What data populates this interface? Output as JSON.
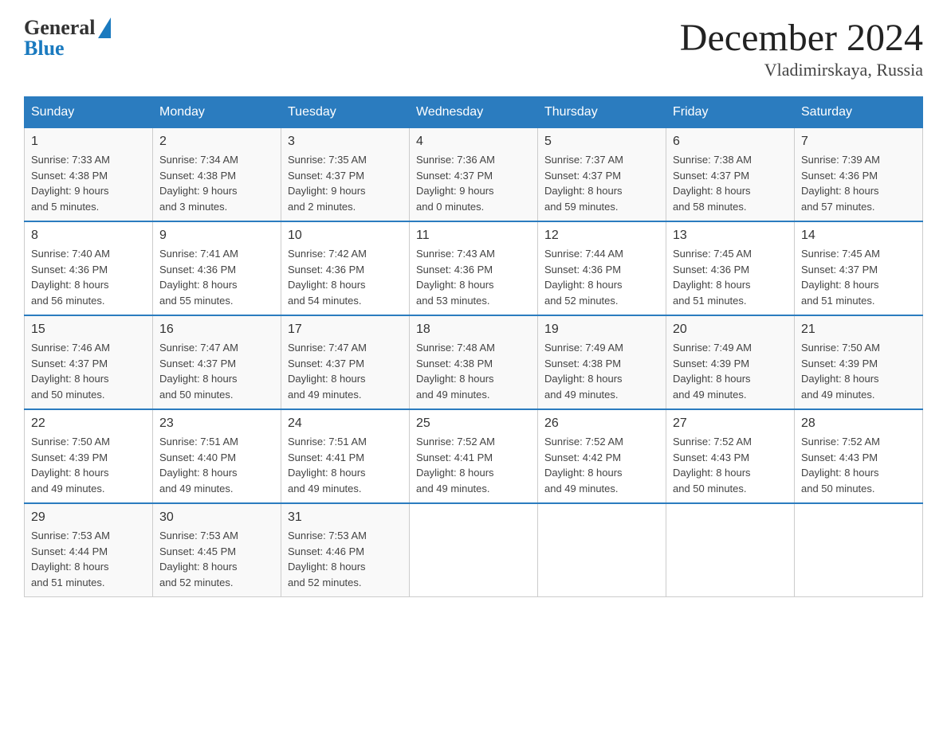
{
  "header": {
    "logo_general": "General",
    "logo_blue": "Blue",
    "title": "December 2024",
    "location": "Vladimirskaya, Russia"
  },
  "days_of_week": [
    "Sunday",
    "Monday",
    "Tuesday",
    "Wednesday",
    "Thursday",
    "Friday",
    "Saturday"
  ],
  "weeks": [
    [
      {
        "day": "1",
        "sunrise": "7:33 AM",
        "sunset": "4:38 PM",
        "daylight_hours": "9",
        "daylight_minutes": "5"
      },
      {
        "day": "2",
        "sunrise": "7:34 AM",
        "sunset": "4:38 PM",
        "daylight_hours": "9",
        "daylight_minutes": "3"
      },
      {
        "day": "3",
        "sunrise": "7:35 AM",
        "sunset": "4:37 PM",
        "daylight_hours": "9",
        "daylight_minutes": "2"
      },
      {
        "day": "4",
        "sunrise": "7:36 AM",
        "sunset": "4:37 PM",
        "daylight_hours": "9",
        "daylight_minutes": "0"
      },
      {
        "day": "5",
        "sunrise": "7:37 AM",
        "sunset": "4:37 PM",
        "daylight_hours": "8",
        "daylight_minutes": "59"
      },
      {
        "day": "6",
        "sunrise": "7:38 AM",
        "sunset": "4:37 PM",
        "daylight_hours": "8",
        "daylight_minutes": "58"
      },
      {
        "day": "7",
        "sunrise": "7:39 AM",
        "sunset": "4:36 PM",
        "daylight_hours": "8",
        "daylight_minutes": "57"
      }
    ],
    [
      {
        "day": "8",
        "sunrise": "7:40 AM",
        "sunset": "4:36 PM",
        "daylight_hours": "8",
        "daylight_minutes": "56"
      },
      {
        "day": "9",
        "sunrise": "7:41 AM",
        "sunset": "4:36 PM",
        "daylight_hours": "8",
        "daylight_minutes": "55"
      },
      {
        "day": "10",
        "sunrise": "7:42 AM",
        "sunset": "4:36 PM",
        "daylight_hours": "8",
        "daylight_minutes": "54"
      },
      {
        "day": "11",
        "sunrise": "7:43 AM",
        "sunset": "4:36 PM",
        "daylight_hours": "8",
        "daylight_minutes": "53"
      },
      {
        "day": "12",
        "sunrise": "7:44 AM",
        "sunset": "4:36 PM",
        "daylight_hours": "8",
        "daylight_minutes": "52"
      },
      {
        "day": "13",
        "sunrise": "7:45 AM",
        "sunset": "4:36 PM",
        "daylight_hours": "8",
        "daylight_minutes": "51"
      },
      {
        "day": "14",
        "sunrise": "7:45 AM",
        "sunset": "4:37 PM",
        "daylight_hours": "8",
        "daylight_minutes": "51"
      }
    ],
    [
      {
        "day": "15",
        "sunrise": "7:46 AM",
        "sunset": "4:37 PM",
        "daylight_hours": "8",
        "daylight_minutes": "50"
      },
      {
        "day": "16",
        "sunrise": "7:47 AM",
        "sunset": "4:37 PM",
        "daylight_hours": "8",
        "daylight_minutes": "50"
      },
      {
        "day": "17",
        "sunrise": "7:47 AM",
        "sunset": "4:37 PM",
        "daylight_hours": "8",
        "daylight_minutes": "49"
      },
      {
        "day": "18",
        "sunrise": "7:48 AM",
        "sunset": "4:38 PM",
        "daylight_hours": "8",
        "daylight_minutes": "49"
      },
      {
        "day": "19",
        "sunrise": "7:49 AM",
        "sunset": "4:38 PM",
        "daylight_hours": "8",
        "daylight_minutes": "49"
      },
      {
        "day": "20",
        "sunrise": "7:49 AM",
        "sunset": "4:39 PM",
        "daylight_hours": "8",
        "daylight_minutes": "49"
      },
      {
        "day": "21",
        "sunrise": "7:50 AM",
        "sunset": "4:39 PM",
        "daylight_hours": "8",
        "daylight_minutes": "49"
      }
    ],
    [
      {
        "day": "22",
        "sunrise": "7:50 AM",
        "sunset": "4:39 PM",
        "daylight_hours": "8",
        "daylight_minutes": "49"
      },
      {
        "day": "23",
        "sunrise": "7:51 AM",
        "sunset": "4:40 PM",
        "daylight_hours": "8",
        "daylight_minutes": "49"
      },
      {
        "day": "24",
        "sunrise": "7:51 AM",
        "sunset": "4:41 PM",
        "daylight_hours": "8",
        "daylight_minutes": "49"
      },
      {
        "day": "25",
        "sunrise": "7:52 AM",
        "sunset": "4:41 PM",
        "daylight_hours": "8",
        "daylight_minutes": "49"
      },
      {
        "day": "26",
        "sunrise": "7:52 AM",
        "sunset": "4:42 PM",
        "daylight_hours": "8",
        "daylight_minutes": "49"
      },
      {
        "day": "27",
        "sunrise": "7:52 AM",
        "sunset": "4:43 PM",
        "daylight_hours": "8",
        "daylight_minutes": "50"
      },
      {
        "day": "28",
        "sunrise": "7:52 AM",
        "sunset": "4:43 PM",
        "daylight_hours": "8",
        "daylight_minutes": "50"
      }
    ],
    [
      {
        "day": "29",
        "sunrise": "7:53 AM",
        "sunset": "4:44 PM",
        "daylight_hours": "8",
        "daylight_minutes": "51"
      },
      {
        "day": "30",
        "sunrise": "7:53 AM",
        "sunset": "4:45 PM",
        "daylight_hours": "8",
        "daylight_minutes": "52"
      },
      {
        "day": "31",
        "sunrise": "7:53 AM",
        "sunset": "4:46 PM",
        "daylight_hours": "8",
        "daylight_minutes": "52"
      },
      null,
      null,
      null,
      null
    ]
  ]
}
